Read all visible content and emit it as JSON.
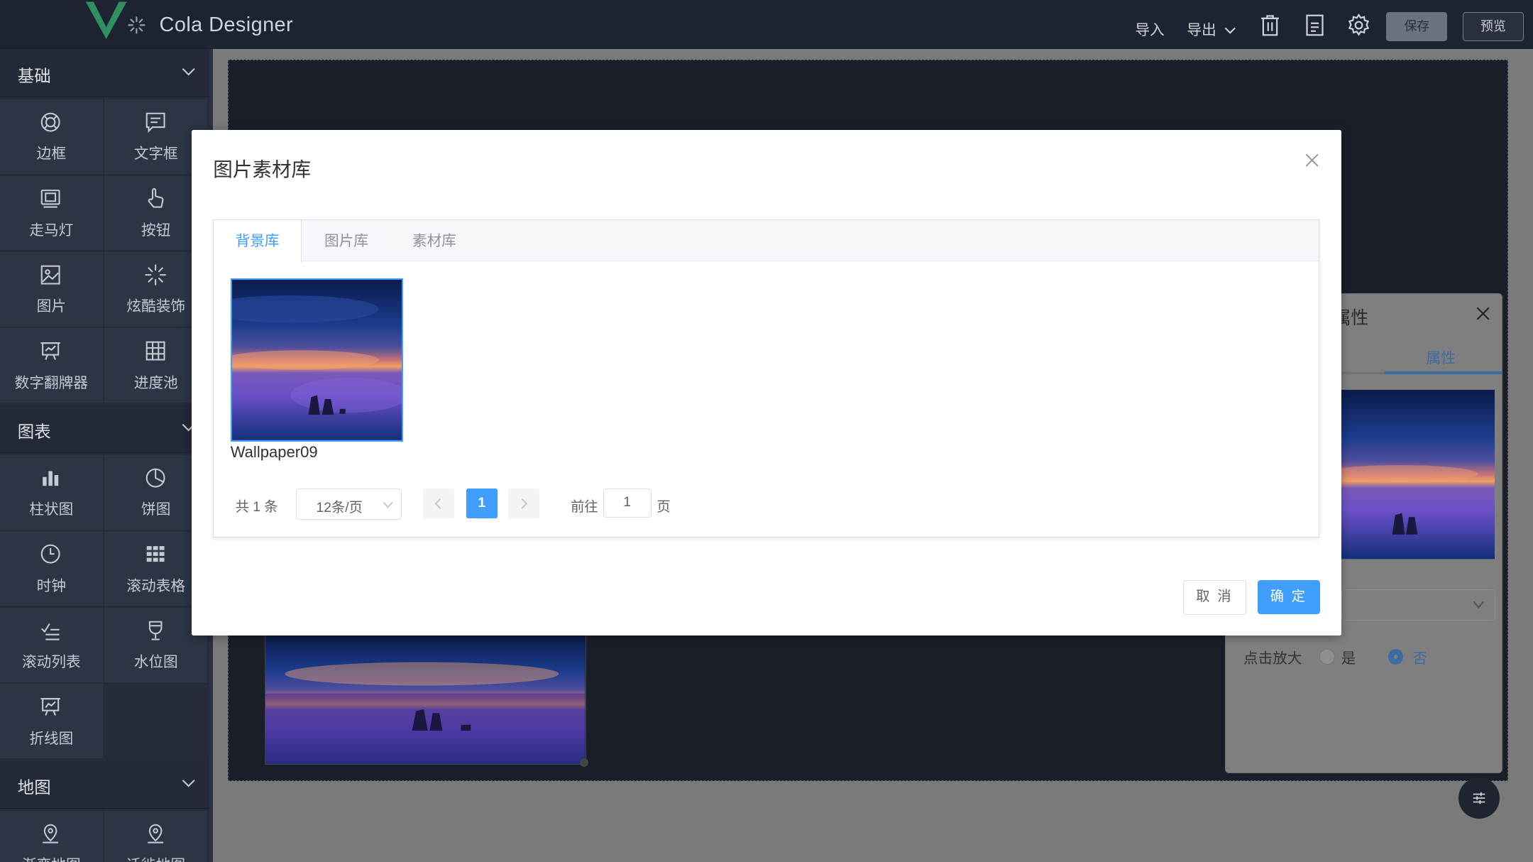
{
  "app": {
    "title": "Cola Designer"
  },
  "topbar": {
    "import_label": "导入",
    "export_label": "导出",
    "save_label": "保存",
    "preview_label": "预览"
  },
  "sidebar": {
    "groups": [
      {
        "label": "基础",
        "items": [
          {
            "label": "边框",
            "icon": "ring-icon"
          },
          {
            "label": "文字框",
            "icon": "text-box-icon"
          },
          {
            "label": "走马灯",
            "icon": "carousel-icon"
          },
          {
            "label": "按钮",
            "icon": "pointer-hand-icon"
          },
          {
            "label": "图片",
            "icon": "image-icon"
          },
          {
            "label": "炫酷装饰",
            "icon": "sparkle-icon"
          },
          {
            "label": "数字翻牌器",
            "icon": "presentation-icon"
          },
          {
            "label": "进度池",
            "icon": "grid-icon"
          }
        ]
      },
      {
        "label": "图表",
        "items": [
          {
            "label": "柱状图",
            "icon": "bar-chart-icon"
          },
          {
            "label": "饼图",
            "icon": "pie-chart-icon"
          },
          {
            "label": "时钟",
            "icon": "clock-icon"
          },
          {
            "label": "滚动表格",
            "icon": "table-icon"
          },
          {
            "label": "滚动列表",
            "icon": "checklist-icon"
          },
          {
            "label": "水位图",
            "icon": "cup-icon"
          },
          {
            "label": "折线图",
            "icon": "line-chart-icon"
          }
        ]
      },
      {
        "label": "地图",
        "items": [
          {
            "label": "渐变地图",
            "icon": "map-pin-icon"
          },
          {
            "label": "迁徙地图",
            "icon": "map-pin-icon"
          }
        ]
      }
    ]
  },
  "property_panel": {
    "title": "属性",
    "tab_label": "属性",
    "zoom_label": "点击放大",
    "yes_label": "是",
    "no_label": "否",
    "selected": "否"
  },
  "dialog": {
    "title": "图片素材库",
    "tabs": [
      {
        "label": "背景库",
        "active": true
      },
      {
        "label": "图片库",
        "active": false
      },
      {
        "label": "素材库",
        "active": false
      }
    ],
    "images": [
      {
        "name": "Wallpaper09"
      }
    ],
    "pagination": {
      "total_text": "共 1 条",
      "page_size": "12条/页",
      "current_page": "1",
      "goto_label": "前往",
      "goto_value": "1",
      "page_suffix": "页"
    },
    "cancel_label": "取 消",
    "confirm_label": "确 定"
  },
  "colors": {
    "primary": "#409eff",
    "topbar_bg": "#1e2331",
    "sidebar_bg": "#262c3a"
  }
}
